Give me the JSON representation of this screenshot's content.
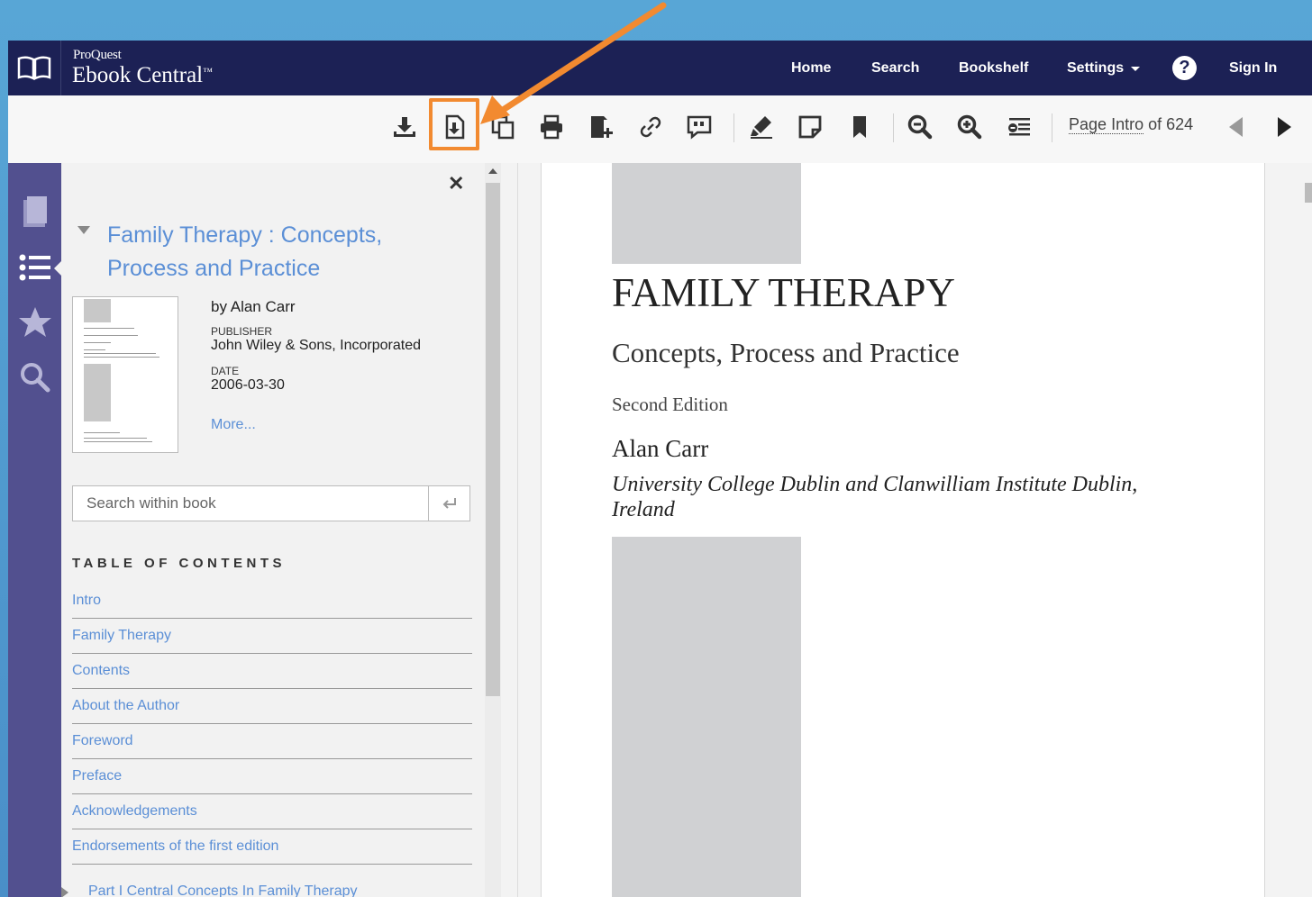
{
  "header": {
    "logo_small": "ProQuest",
    "logo_big": "Ebook Central",
    "logo_tm": "™",
    "nav": [
      "Home",
      "Search",
      "Bookshelf",
      "Settings"
    ],
    "help": "?",
    "sign_in": "Sign In"
  },
  "toolbar": {
    "icons": [
      "download-icon",
      "download-pdf-chapter-icon",
      "copy-icon",
      "print-icon",
      "add-to-bookshelf-icon",
      "link-icon",
      "cite-icon",
      "highlight-icon",
      "note-icon",
      "bookmark-icon",
      "zoom-out-icon",
      "zoom-in-icon",
      "fit-page-icon"
    ],
    "page_prefix": "Page",
    "page_value": "Intro",
    "page_of": "of 624"
  },
  "accent": {
    "brand": "#1c2155",
    "rail": "#52508f",
    "link": "#5b8fd6",
    "callout": "#f28a30"
  },
  "sidebar": {
    "rail_icons": [
      "book-icon",
      "list-icon",
      "star-icon",
      "search-icon"
    ],
    "book_title": "Family Therapy : Concepts, Process and Practice",
    "author": "by Alan Carr",
    "publisher_label": "PUBLISHER",
    "publisher": "John Wiley & Sons, Incorporated",
    "date_label": "DATE",
    "date": "2006-03-30",
    "more": "More...",
    "search_placeholder": "Search within book",
    "toc_heading": "TABLE OF CONTENTS",
    "toc": [
      "Intro",
      "Family Therapy",
      "Contents",
      "About the Author",
      "Foreword",
      "Preface",
      "Acknowledgements",
      "Endorsements of the first edition"
    ],
    "toc_part": "Part I Central Concepts In Family Therapy"
  },
  "page": {
    "title": "FAMILY THERAPY",
    "subtitle": "Concepts, Process and Practice",
    "edition": "Second Edition",
    "author": "Alan Carr",
    "affiliation": "University College Dublin and Clanwilliam Institute Dublin, Ireland"
  }
}
